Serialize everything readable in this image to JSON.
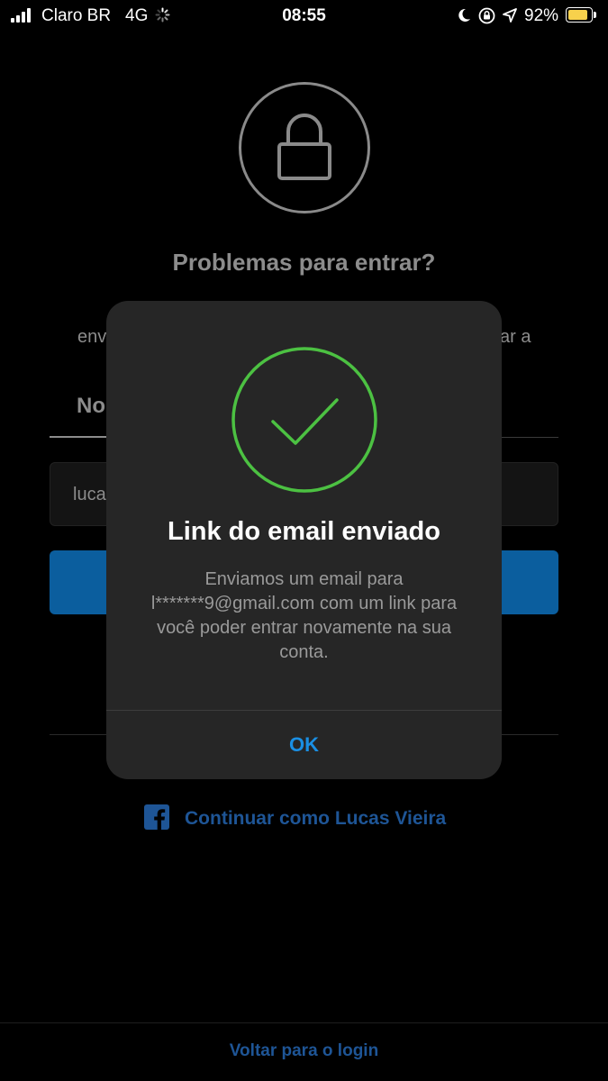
{
  "status_bar": {
    "carrier": "Claro BR",
    "network": "4G",
    "time": "08:55",
    "battery_percent": "92%",
    "battery_level": 0.92,
    "battery_color": "#f7d14c"
  },
  "background": {
    "title": "Problemas para entrar?",
    "description_fragment_left": "env",
    "description_fragment_right": "ar a",
    "tab_fragment": "No",
    "input_value_fragment": "luca",
    "facebook_continue_label": "Continuar como Lucas Vieira",
    "back_to_login": "Voltar para o login"
  },
  "modal": {
    "title": "Link do email enviado",
    "message": "Enviamos um email para l*******9@gmail.com com um link para você poder entrar novamente na sua conta.",
    "ok_label": "OK",
    "check_color": "#4cc142"
  },
  "colors": {
    "accent_blue": "#1a8fe3",
    "facebook_blue": "#1e5596",
    "button_blue": "#0b5e9e"
  },
  "icons": [
    "signal-icon",
    "loading-spinner-icon",
    "moon-icon",
    "orientation-lock-icon",
    "location-arrow-icon",
    "battery-icon",
    "lock-icon",
    "check-icon",
    "facebook-icon"
  ]
}
